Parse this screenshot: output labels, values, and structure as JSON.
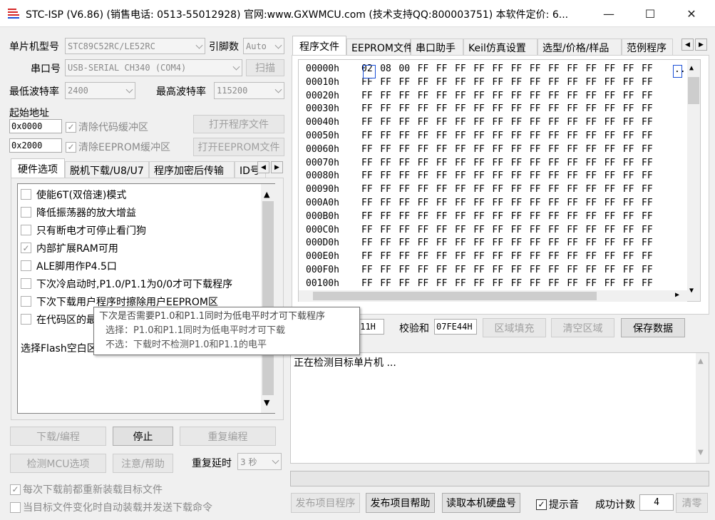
{
  "window": {
    "title": "STC-ISP (V6.86) (销售电话: 0513-55012928) 官网:www.GXWMCU.com  (技术支持QQ:800003751) 本软件定价: 6...",
    "minimize": "—",
    "maximize": "☐",
    "close": "✕"
  },
  "left": {
    "mcu_label": "单片机型号",
    "mcu_value": "STC89C52RC/LE52RC",
    "pins_label": "引脚数",
    "pins_value": "Auto",
    "port_label": "串口号",
    "port_value": "USB-SERIAL CH340 (COM4)",
    "scan_button": "扫描",
    "min_baud_label": "最低波特率",
    "min_baud_value": "2400",
    "max_baud_label": "最高波特率",
    "max_baud_value": "115200",
    "start_addr_label": "起始地址",
    "addr1": "0x0000",
    "addr2": "0x2000",
    "clear_code_label": "清除代码缓冲区",
    "clear_eeprom_label": "清除EEPROM缓冲区",
    "open_prog_button": "打开程序文件",
    "open_eeprom_button": "打开EEPROM文件",
    "tabs": [
      "硬件选项",
      "脱机下载/U8/U7",
      "程序加密后传输",
      "ID号"
    ],
    "options": [
      {
        "label": "使能6T(双倍速)模式",
        "checked": false
      },
      {
        "label": "降低振荡器的放大增益",
        "checked": false
      },
      {
        "label": "只有断电才可停止看门狗",
        "checked": false
      },
      {
        "label": "内部扩展RAM可用",
        "checked": true
      },
      {
        "label": "ALE脚用作P4.5口",
        "checked": false
      },
      {
        "label": "下次冷启动时,P1.0/P1.1为0/0才可下载程序",
        "checked": false
      },
      {
        "label": "下次下载用户程序时擦除用户EEPROM区",
        "checked": false
      },
      {
        "label": "在代码区的最",
        "checked": false
      }
    ],
    "flash_label": "选择Flash空白区",
    "download_button": "下载/编程",
    "stop_button": "停止",
    "reprogram_button": "重复编程",
    "check_mcu_button": "检测MCU选项",
    "help_button": "注意/帮助",
    "repeat_delay_label": "重复延时",
    "repeat_delay_value": "3 秒",
    "reload_label": "每次下载前都重新装载目标文件",
    "auto_send_label": "当目标文件变化时自动装载并发送下载命令"
  },
  "tooltip": {
    "line1": "下次是否需要P1.0和P1.1同时为低电平时才可下载程序",
    "line2": "选择：P1.0和P1.1同时为低电平时才可下载",
    "line3": "不选：下载时不检测P1.0和P1.1的电平"
  },
  "right": {
    "tabs": [
      "程序文件",
      "EEPROM文件",
      "串口助手",
      "Keil仿真设置",
      "选型/价格/样品",
      "范例程序"
    ],
    "hex": {
      "rows": [
        {
          "addr": "00000h",
          "bytes": [
            "02",
            "08",
            "00",
            "FF",
            "FF",
            "FF",
            "FF",
            "FF",
            "FF",
            "FF",
            "FF",
            "FF",
            "FF",
            "FF",
            "FF",
            "FF"
          ],
          "ascii": ".."
        },
        {
          "addr": "00010h",
          "bytes": [
            "FF",
            "FF",
            "FF",
            "FF",
            "FF",
            "FF",
            "FF",
            "FF",
            "FF",
            "FF",
            "FF",
            "FF",
            "FF",
            "FF",
            "FF",
            "FF"
          ]
        },
        {
          "addr": "00020h",
          "bytes": [
            "FF",
            "FF",
            "FF",
            "FF",
            "FF",
            "FF",
            "FF",
            "FF",
            "FF",
            "FF",
            "FF",
            "FF",
            "FF",
            "FF",
            "FF",
            "FF"
          ]
        },
        {
          "addr": "00030h",
          "bytes": [
            "FF",
            "FF",
            "FF",
            "FF",
            "FF",
            "FF",
            "FF",
            "FF",
            "FF",
            "FF",
            "FF",
            "FF",
            "FF",
            "FF",
            "FF",
            "FF"
          ]
        },
        {
          "addr": "00040h",
          "bytes": [
            "FF",
            "FF",
            "FF",
            "FF",
            "FF",
            "FF",
            "FF",
            "FF",
            "FF",
            "FF",
            "FF",
            "FF",
            "FF",
            "FF",
            "FF",
            "FF"
          ]
        },
        {
          "addr": "00050h",
          "bytes": [
            "FF",
            "FF",
            "FF",
            "FF",
            "FF",
            "FF",
            "FF",
            "FF",
            "FF",
            "FF",
            "FF",
            "FF",
            "FF",
            "FF",
            "FF",
            "FF"
          ]
        },
        {
          "addr": "00060h",
          "bytes": [
            "FF",
            "FF",
            "FF",
            "FF",
            "FF",
            "FF",
            "FF",
            "FF",
            "FF",
            "FF",
            "FF",
            "FF",
            "FF",
            "FF",
            "FF",
            "FF"
          ]
        },
        {
          "addr": "00070h",
          "bytes": [
            "FF",
            "FF",
            "FF",
            "FF",
            "FF",
            "FF",
            "FF",
            "FF",
            "FF",
            "FF",
            "FF",
            "FF",
            "FF",
            "FF",
            "FF",
            "FF"
          ]
        },
        {
          "addr": "00080h",
          "bytes": [
            "FF",
            "FF",
            "FF",
            "FF",
            "FF",
            "FF",
            "FF",
            "FF",
            "FF",
            "FF",
            "FF",
            "FF",
            "FF",
            "FF",
            "FF",
            "FF"
          ]
        },
        {
          "addr": "00090h",
          "bytes": [
            "FF",
            "FF",
            "FF",
            "FF",
            "FF",
            "FF",
            "FF",
            "FF",
            "FF",
            "FF",
            "FF",
            "FF",
            "FF",
            "FF",
            "FF",
            "FF"
          ]
        },
        {
          "addr": "000A0h",
          "bytes": [
            "FF",
            "FF",
            "FF",
            "FF",
            "FF",
            "FF",
            "FF",
            "FF",
            "FF",
            "FF",
            "FF",
            "FF",
            "FF",
            "FF",
            "FF",
            "FF"
          ]
        },
        {
          "addr": "000B0h",
          "bytes": [
            "FF",
            "FF",
            "FF",
            "FF",
            "FF",
            "FF",
            "FF",
            "FF",
            "FF",
            "FF",
            "FF",
            "FF",
            "FF",
            "FF",
            "FF",
            "FF"
          ]
        },
        {
          "addr": "000C0h",
          "bytes": [
            "FF",
            "FF",
            "FF",
            "FF",
            "FF",
            "FF",
            "FF",
            "FF",
            "FF",
            "FF",
            "FF",
            "FF",
            "FF",
            "FF",
            "FF",
            "FF"
          ]
        },
        {
          "addr": "000D0h",
          "bytes": [
            "FF",
            "FF",
            "FF",
            "FF",
            "FF",
            "FF",
            "FF",
            "FF",
            "FF",
            "FF",
            "FF",
            "FF",
            "FF",
            "FF",
            "FF",
            "FF"
          ]
        },
        {
          "addr": "000E0h",
          "bytes": [
            "FF",
            "FF",
            "FF",
            "FF",
            "FF",
            "FF",
            "FF",
            "FF",
            "FF",
            "FF",
            "FF",
            "FF",
            "FF",
            "FF",
            "FF",
            "FF"
          ]
        },
        {
          "addr": "000F0h",
          "bytes": [
            "FF",
            "FF",
            "FF",
            "FF",
            "FF",
            "FF",
            "FF",
            "FF",
            "FF",
            "FF",
            "FF",
            "FF",
            "FF",
            "FF",
            "FF",
            "FF"
          ]
        },
        {
          "addr": "00100h",
          "bytes": [
            "FF",
            "FF",
            "FF",
            "FF",
            "FF",
            "FF",
            "FF",
            "FF",
            "FF",
            "FF",
            "FF",
            "FF",
            "FF",
            "FF",
            "FF",
            "FF"
          ]
        }
      ]
    },
    "size_value": "811H",
    "checksum_label": "校验和",
    "checksum_value": "07FE44H",
    "fill_button": "区域填充",
    "clear_button": "清空区域",
    "save_button": "保存数据",
    "log_text": "正在检测目标单片机 ...",
    "publish_prog_button": "发布项目程序",
    "publish_help_button": "发布项目帮助",
    "read_disk_button": "读取本机硬盘号",
    "sound_label": "提示音",
    "success_label": "成功计数",
    "success_value": "4",
    "reset_button": "清零"
  },
  "colors": {
    "accent": "#1a4fd6",
    "logo_red": "#d62828"
  }
}
